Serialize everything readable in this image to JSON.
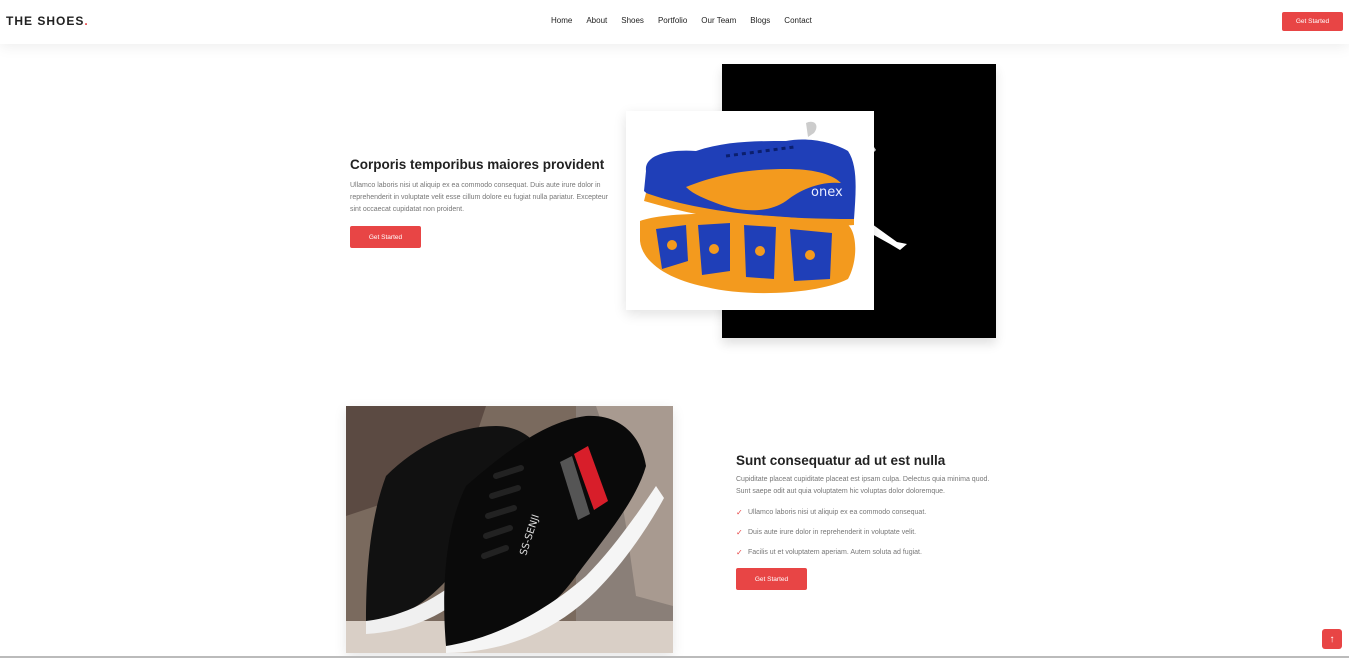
{
  "header": {
    "logo": "THE SHOES",
    "logo_dot": ".",
    "nav": [
      "Home",
      "About",
      "Shoes",
      "Portfolio",
      "Our Team",
      "Blogs",
      "Contact"
    ],
    "cta": "Get Started"
  },
  "section1": {
    "title": "Corporis temporibus maiores provident",
    "text": "Ullamco laboris nisi ut aliquip ex ea commodo consequat. Duis aute irure dolor in reprehenderit in voluptate velit esse cillum dolore eu fugiat nulla pariatur. Excepteur sint occaecat cupidatat non proident.",
    "button": "Get Started",
    "shoe_brand": "onex"
  },
  "section2": {
    "title": "Sunt consequatur ad ut est nulla",
    "text": "Cupiditate placeat cupiditate placeat est ipsam culpa. Delectus quia minima quod. Sunt saepe odit aut quia voluptatem hic voluptas dolor doloremque.",
    "checks": [
      "Ullamco laboris nisi ut aliquip ex ea commodo consequat.",
      "Duis aute irure dolor in reprehenderit in voluptate velit.",
      "Facilis ut et voluptatem aperiam. Autem soluta ad fugiat."
    ],
    "button": "Get Started",
    "shoe_brand": "SS-SENJI"
  },
  "scroll_top_icon": "arrow-up-icon",
  "colors": {
    "accent": "#e84545",
    "shoe_blue": "#1f3fb8",
    "shoe_orange": "#f39a1e"
  }
}
